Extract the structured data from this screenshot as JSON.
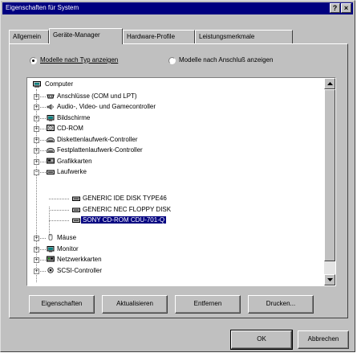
{
  "window": {
    "title": "Eigenschaften für System",
    "help_label": "?",
    "close_label": "×"
  },
  "tabs": [
    "Allgemein",
    "Geräte-Manager",
    "Hardware-Profile",
    "Leistungsmerkmale"
  ],
  "active_tab": 1,
  "view_options": {
    "by_type": "Modelle nach Typ anzeigen",
    "by_connection": "Modelle nach Anschluß anzeigen",
    "selected": "by_type"
  },
  "device_tree": {
    "root": "Computer",
    "categories": [
      "Anschlüsse (COM und LPT)",
      "Audio-, Video- und Gamecontroller",
      "Bildschirme",
      "CD-ROM",
      "Diskettenlaufwerk-Controller",
      "Festplattenlaufwerk-Controller",
      "Grafikkarten",
      "Laufwerke",
      "Mäuse",
      "Monitor",
      "Netzwerkkarten",
      "SCSI-Controller"
    ],
    "expanded_category": "Laufwerke",
    "drives": [
      "GENERIC IDE DISK TYPE46",
      "GENERIC NEC FLOPPY DISK",
      "SONY CD-ROM CDU-701-Q"
    ],
    "selected_drive": "SONY CD-ROM CDU-701-Q"
  },
  "actions": {
    "properties": "Eigenschaften",
    "refresh": "Aktualisieren",
    "remove": "Entfernen",
    "print": "Drucken..."
  },
  "dialog": {
    "ok": "OK",
    "cancel": "Abbrechen"
  }
}
